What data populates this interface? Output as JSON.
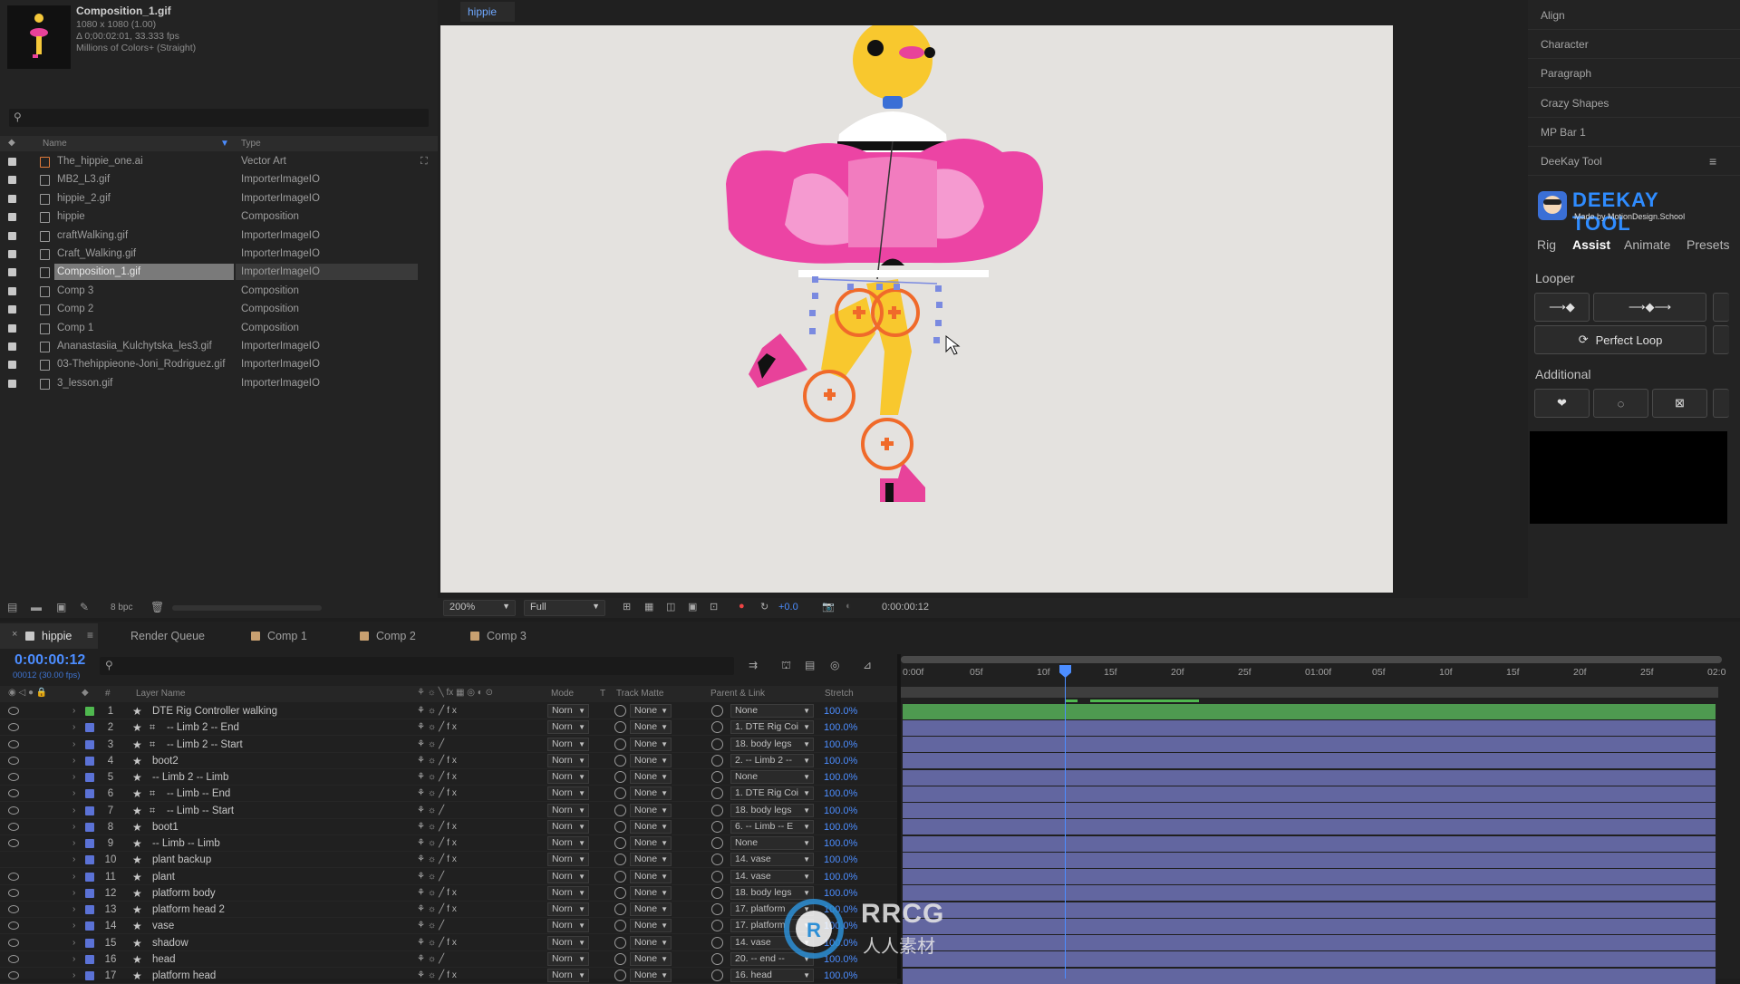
{
  "project": {
    "comp_name": "Composition_1.gif",
    "dims": "1080 x 1080 (1.00)",
    "duration": "Δ 0;00:02:01, 33.333 fps",
    "colors": "Millions of Colors+ (Straight)",
    "search_placeholder": "",
    "col_name": "Name",
    "col_type": "Type",
    "items": [
      {
        "name": "The_hippie_one.ai",
        "type": "Vector Art"
      },
      {
        "name": "MB2_L3.gif",
        "type": "ImporterImageIO"
      },
      {
        "name": "hippie_2.gif",
        "type": "ImporterImageIO"
      },
      {
        "name": "hippie",
        "type": "Composition"
      },
      {
        "name": "craftWalking.gif",
        "type": "ImporterImageIO"
      },
      {
        "name": "Craft_Walking.gif",
        "type": "ImporterImageIO"
      },
      {
        "name": "Composition_1.gif",
        "type": "ImporterImageIO",
        "selected": true
      },
      {
        "name": "Comp 3",
        "type": "Composition"
      },
      {
        "name": "Comp 2",
        "type": "Composition"
      },
      {
        "name": "Comp 1",
        "type": "Composition"
      },
      {
        "name": "Ananastasiia_Kulchytska_les3.gif",
        "type": "ImporterImageIO"
      },
      {
        "name": "03-Thehippieone-Joni_Rodriguez.gif",
        "type": "ImporterImageIO"
      },
      {
        "name": "3_lesson.gif",
        "type": "ImporterImageIO"
      }
    ],
    "bpc": "8 bpc"
  },
  "viewer": {
    "tab": "hippie",
    "zoom": "200%",
    "resolution": "Full",
    "exposure": "+0.0",
    "timecode": "0:00:00:12"
  },
  "right_panel": {
    "items": [
      "Align",
      "Character",
      "Paragraph",
      "Crazy Shapes",
      "MP Bar 1",
      "DeeKay Tool"
    ],
    "deekay": {
      "logo_text": "DEEKAY TOOL",
      "logo_sub": "Made by MotionDesign.School",
      "tabs": [
        "Rig",
        "Assist",
        "Animate",
        "Presets"
      ],
      "active_tab": "Assist",
      "looper": "Looper",
      "perfect_loop": "Perfect Loop",
      "additional": "Additional"
    }
  },
  "timeline": {
    "tabs": [
      {
        "label": "hippie",
        "color": "#c8c8c8"
      },
      {
        "label": "Render Queue",
        "color": ""
      },
      {
        "label": "Comp 1",
        "color": "#c8a070"
      },
      {
        "label": "Comp 2",
        "color": "#c8a070"
      },
      {
        "label": "Comp 3",
        "color": "#c8a070"
      }
    ],
    "timecode": "0:00:00:12",
    "frame_info": "00012 (30.00 fps)",
    "headers": {
      "layer_name": "Layer Name",
      "mode": "Mode",
      "t": "T",
      "track_matte": "Track Matte",
      "parent": "Parent & Link",
      "stretch": "Stretch"
    },
    "ruler": [
      "0:00f",
      "05f",
      "10f",
      "15f",
      "20f",
      "25f",
      "01:00f",
      "05f",
      "10f",
      "15f",
      "20f",
      "25f",
      "02:0"
    ],
    "layers": [
      {
        "num": "1",
        "name": "DTE Rig Controller walking",
        "shape": false,
        "mode": "Norn",
        "matte": "None",
        "parent": "None",
        "stretch": "100.0%",
        "color": "#4fb84f",
        "fx": true
      },
      {
        "num": "2",
        "name": "-- Limb 2 -- End",
        "shape": true,
        "mode": "Norn",
        "matte": "None",
        "parent": "1. DTE Rig Coi",
        "stretch": "100.0%",
        "color": "#5b72d6",
        "fx": true
      },
      {
        "num": "3",
        "name": "-- Limb 2 -- Start",
        "shape": true,
        "mode": "Norn",
        "matte": "None",
        "parent": "18. body legs",
        "stretch": "100.0%",
        "color": "#5b72d6",
        "fx": false
      },
      {
        "num": "4",
        "name": "boot2",
        "shape": false,
        "mode": "Norn",
        "matte": "None",
        "parent": "2. -- Limb 2 --",
        "stretch": "100.0%",
        "color": "#5b72d6",
        "fx": true
      },
      {
        "num": "5",
        "name": "-- Limb 2 -- Limb",
        "shape": false,
        "mode": "Norn",
        "matte": "None",
        "parent": "None",
        "stretch": "100.0%",
        "color": "#5b72d6",
        "fx": true
      },
      {
        "num": "6",
        "name": "-- Limb -- End",
        "shape": true,
        "mode": "Norn",
        "matte": "None",
        "parent": "1. DTE Rig Coi",
        "stretch": "100.0%",
        "color": "#5b72d6",
        "fx": true
      },
      {
        "num": "7",
        "name": "-- Limb -- Start",
        "shape": true,
        "mode": "Norn",
        "matte": "None",
        "parent": "18. body legs",
        "stretch": "100.0%",
        "color": "#5b72d6",
        "fx": false
      },
      {
        "num": "8",
        "name": "boot1",
        "shape": false,
        "mode": "Norn",
        "matte": "None",
        "parent": "6. -- Limb -- E",
        "stretch": "100.0%",
        "color": "#5b72d6",
        "fx": true
      },
      {
        "num": "9",
        "name": "-- Limb -- Limb",
        "shape": false,
        "mode": "Norn",
        "matte": "None",
        "parent": "None",
        "stretch": "100.0%",
        "color": "#5b72d6",
        "fx": true
      },
      {
        "num": "10",
        "name": "plant backup",
        "shape": false,
        "mode": "Norn",
        "matte": "None",
        "parent": "14. vase",
        "stretch": "100.0%",
        "color": "#5b72d6",
        "fx": true
      },
      {
        "num": "11",
        "name": "plant",
        "shape": false,
        "mode": "Norn",
        "matte": "None",
        "parent": "14. vase",
        "stretch": "100.0%",
        "color": "#5b72d6",
        "fx": false
      },
      {
        "num": "12",
        "name": "platform body",
        "shape": false,
        "mode": "Norn",
        "matte": "None",
        "parent": "18. body legs",
        "stretch": "100.0%",
        "color": "#5b72d6",
        "fx": true
      },
      {
        "num": "13",
        "name": "platform head 2",
        "shape": false,
        "mode": "Norn",
        "matte": "None",
        "parent": "17. platform",
        "stretch": "100.0%",
        "color": "#5b72d6",
        "fx": true
      },
      {
        "num": "14",
        "name": "vase",
        "shape": false,
        "mode": "Norn",
        "matte": "None",
        "parent": "17. platform",
        "stretch": "100.0%",
        "color": "#5b72d6",
        "fx": false
      },
      {
        "num": "15",
        "name": "shadow",
        "shape": false,
        "mode": "Norn",
        "matte": "None",
        "parent": "14. vase",
        "stretch": "100.0%",
        "color": "#5b72d6",
        "fx": true
      },
      {
        "num": "16",
        "name": "head",
        "shape": false,
        "mode": "Norn",
        "matte": "None",
        "parent": "20. -- end --",
        "stretch": "100.0%",
        "color": "#5b72d6",
        "fx": false
      },
      {
        "num": "17",
        "name": "platform head",
        "shape": false,
        "mode": "Norn",
        "matte": "None",
        "parent": "16. head",
        "stretch": "100.0%",
        "color": "#5b72d6",
        "fx": true
      }
    ]
  },
  "watermark": {
    "text": "RRCG",
    "sub": "人人素材"
  }
}
